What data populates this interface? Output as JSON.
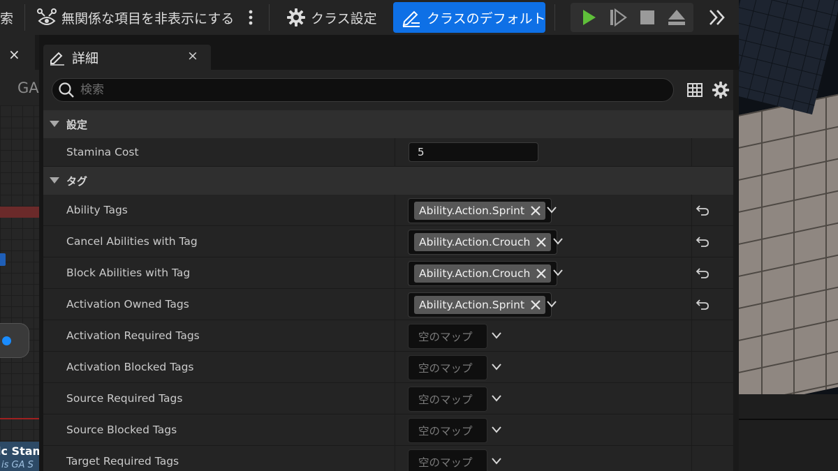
{
  "toolbar": {
    "search_partial": "索",
    "hide_unrelated": "無関係な項目を非表示にする",
    "class_settings": "クラス設定",
    "class_defaults": "クラスのデフォルト"
  },
  "left_panel": {
    "tab_close": "×",
    "graph_label": "GA",
    "node_title": "lc Stam",
    "node_subtitle": "is GA S"
  },
  "details": {
    "tab_title": "詳細",
    "tab_close": "×",
    "search": {
      "placeholder": "検索",
      "value": ""
    },
    "sections": {
      "settings": "設定",
      "tags": "タグ"
    },
    "stamina_cost": {
      "label": "Stamina Cost",
      "value": "5"
    },
    "tag_rows": [
      {
        "label": "Ability Tags",
        "tag": "Ability.Action.Sprint"
      },
      {
        "label": "Cancel Abilities with Tag",
        "tag": "Ability.Action.Crouch"
      },
      {
        "label": "Block Abilities with Tag",
        "tag": "Ability.Action.Crouch"
      },
      {
        "label": "Activation Owned Tags",
        "tag": "Ability.Action.Sprint"
      }
    ],
    "empty_rows": [
      {
        "label": "Activation Required Tags",
        "value": "空のマップ"
      },
      {
        "label": "Activation Blocked Tags",
        "value": "空のマップ"
      },
      {
        "label": "Source Required Tags",
        "value": "空のマップ"
      },
      {
        "label": "Source Blocked Tags",
        "value": "空のマップ"
      },
      {
        "label": "Target Required Tags",
        "value": "空のマップ"
      }
    ]
  },
  "colors": {
    "accent_blue": "#0e70e6",
    "play_green": "#5fbf3a",
    "panel_bg": "#242424",
    "section_bg": "#2f2f2f"
  },
  "icons": {
    "hide_unrelated": "eye-nodes-icon",
    "class_settings": "gear-icon",
    "class_defaults": "pencil-list-icon",
    "play": "play-icon",
    "step": "step-forward-icon",
    "stop": "stop-icon",
    "eject": "eject-icon",
    "more": "double-chevron-right-icon",
    "search": "search-icon",
    "table_view": "table-icon",
    "settings": "gear-icon",
    "reset": "reset-arrow-icon"
  }
}
